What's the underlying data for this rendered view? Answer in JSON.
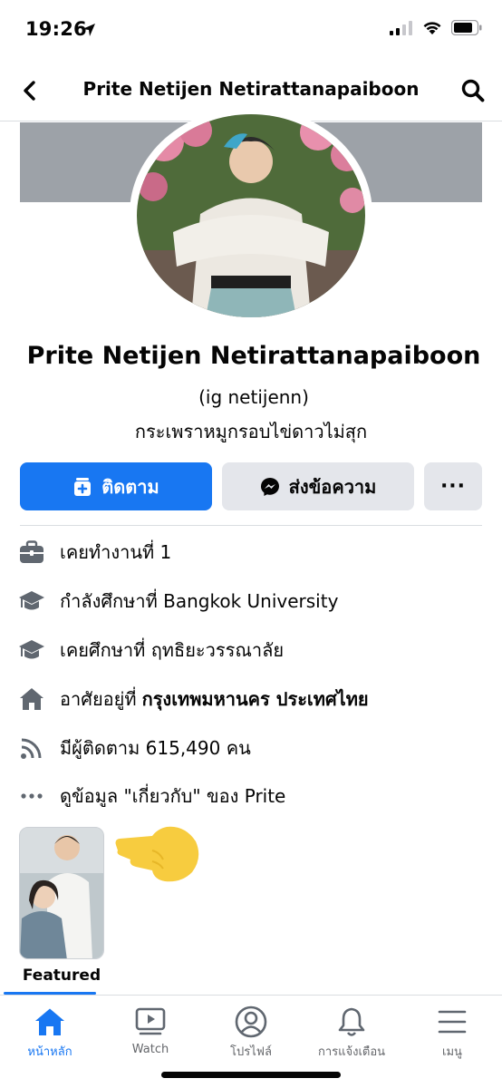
{
  "status_bar": {
    "time": "19:26",
    "icons": [
      "location-arrow-icon",
      "cellular-signal-icon",
      "wifi-icon",
      "battery-icon"
    ]
  },
  "nav": {
    "title": "Prite Netijen Netirattanapaiboon",
    "back_icon": "chevron-left-icon",
    "search_icon": "search-icon"
  },
  "profile": {
    "name": "Prite Netijen Netirattanapaiboon",
    "alt_name": "(ig netijenn)",
    "bio": "กระเพราหมูกรอบไข่ดาวไม่สุก"
  },
  "actions": {
    "follow_label": "ติดตาม",
    "message_label": "ส่งข้อความ",
    "more_label": "···"
  },
  "info": [
    {
      "icon": "briefcase-icon",
      "text": "เคยทำงานที่ 1",
      "bold": ""
    },
    {
      "icon": "graduation-cap-icon",
      "text": "กำลังศึกษาที่ Bangkok University",
      "bold": ""
    },
    {
      "icon": "graduation-cap-icon",
      "text": "เคยศึกษาที่ ฤทธิยะวรรณาลัย",
      "bold": ""
    },
    {
      "icon": "home-icon",
      "text": "อาศัยอยู่ที่ ",
      "bold": "กรุงเทพมหานคร ประเทศไทย"
    },
    {
      "icon": "rss-feed-icon",
      "text": "มีผู้ติดตาม 615,490 คน",
      "bold": ""
    },
    {
      "icon": "more-dots-icon",
      "text": "ดูข้อมูล \"เกี่ยวกับ\" ของ Prite",
      "bold": ""
    }
  ],
  "featured": {
    "label": "Featured"
  },
  "tabs": [
    {
      "label": "หน้าหลัก",
      "icon": "home-icon",
      "active": true
    },
    {
      "label": "Watch",
      "icon": "watch-video-icon",
      "active": false
    },
    {
      "label": "โปรไฟล์",
      "icon": "profile-icon",
      "active": false
    },
    {
      "label": "การแจ้งเตือน",
      "icon": "bell-icon",
      "active": false
    },
    {
      "label": "เมนู",
      "icon": "menu-icon",
      "active": false
    }
  ],
  "colors": {
    "accent": "#1877f2",
    "button_secondary": "#e4e6eb",
    "text_secondary": "#65676b",
    "cover": "#9da2a8",
    "pointer_emoji": "#f7cc3f"
  }
}
